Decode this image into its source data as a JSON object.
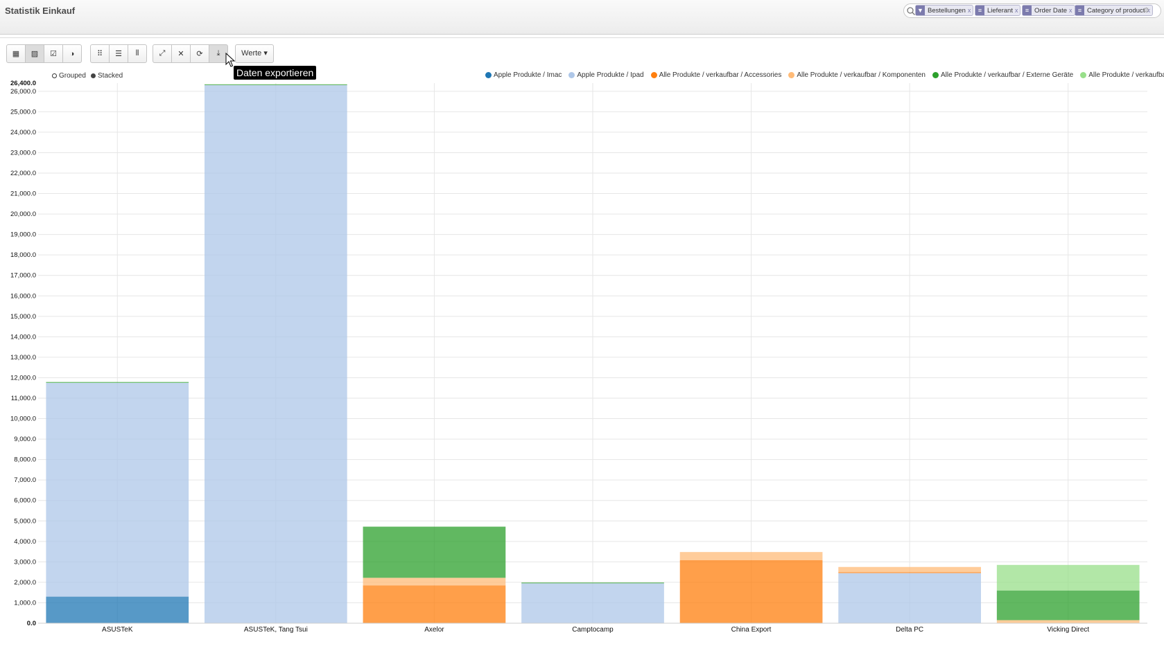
{
  "header": {
    "title": "Statistik Einkauf",
    "facets": [
      {
        "label": "Bestellungen",
        "icon": "filter-icon"
      },
      {
        "label": "Lieferant",
        "icon": "group-icon"
      },
      {
        "label": "Order Date",
        "icon": "group-icon"
      },
      {
        "label": "Category of product",
        "icon": "group-icon"
      }
    ]
  },
  "toolbar": {
    "view_buttons": [
      "table-view",
      "graph-view",
      "checkbox",
      "pie-mode"
    ],
    "mode_buttons": [
      "grid-mode",
      "list-mode",
      "columns-mode"
    ],
    "action_buttons": [
      "expand",
      "collapse",
      "refresh",
      "export"
    ],
    "measures_label": "Werte ▾",
    "tooltip": "Daten exportieren"
  },
  "modes": {
    "grouped": "Grouped",
    "stacked": "Stacked"
  },
  "chart_data": {
    "type": "bar",
    "stacked": true,
    "categories": [
      "ASUSTeK",
      "ASUSTeK, Tang Tsui",
      "Axelor",
      "Camptocamp",
      "China Export",
      "Delta PC",
      "Vicking Direct"
    ],
    "ylim": [
      0,
      26400
    ],
    "yticks": [
      0,
      1000,
      2000,
      3000,
      4000,
      5000,
      6000,
      7000,
      8000,
      9000,
      10000,
      11000,
      12000,
      13000,
      14000,
      15000,
      16000,
      17000,
      18000,
      19000,
      20000,
      21000,
      22000,
      23000,
      24000,
      25000,
      26000
    ],
    "ytick_labels": [
      "0.0",
      "1,000.0",
      "2,000.0",
      "3,000.0",
      "4,000.0",
      "5,000.0",
      "6,000.0",
      "7,000.0",
      "8,000.0",
      "9,000.0",
      "10,000.0",
      "11,000.0",
      "12,000.0",
      "13,000.0",
      "14,000.0",
      "15,000.0",
      "16,000.0",
      "17,000.0",
      "18,000.0",
      "19,000.0",
      "20,000.0",
      "21,000.0",
      "22,000.0",
      "23,000.0",
      "24,000.0",
      "25,000.0",
      "26,000.0"
    ],
    "ymax_label": "26,400.0",
    "grid": true,
    "legend_position": "top-right",
    "series": [
      {
        "name": "Apple Produkte / Imac",
        "color": "#1f77b4",
        "values": [
          1300,
          0,
          0,
          0,
          0,
          0,
          0
        ]
      },
      {
        "name": "Apple Produkte / Ipad",
        "color": "#aec7e8",
        "values": [
          10450,
          26300,
          0,
          1950,
          0,
          2450,
          0
        ]
      },
      {
        "name": "Alle Produkte / verkaufbar / Accessories",
        "color": "#ff7f0e",
        "values": [
          0,
          0,
          1850,
          0,
          3080,
          50,
          0
        ]
      },
      {
        "name": "Alle Produkte / verkaufbar / Komponenten",
        "color": "#ffbb78",
        "values": [
          0,
          0,
          370,
          0,
          400,
          250,
          150
        ]
      },
      {
        "name": "Alle Produkte / verkaufbar / Externe Geräte",
        "color": "#2ca02c",
        "values": [
          40,
          40,
          2500,
          40,
          0,
          0,
          1450
        ]
      },
      {
        "name": "Alle Produkte / verkaufbar / Software",
        "color": "#98df8a",
        "values": [
          0,
          0,
          0,
          0,
          0,
          0,
          1250
        ]
      }
    ]
  }
}
